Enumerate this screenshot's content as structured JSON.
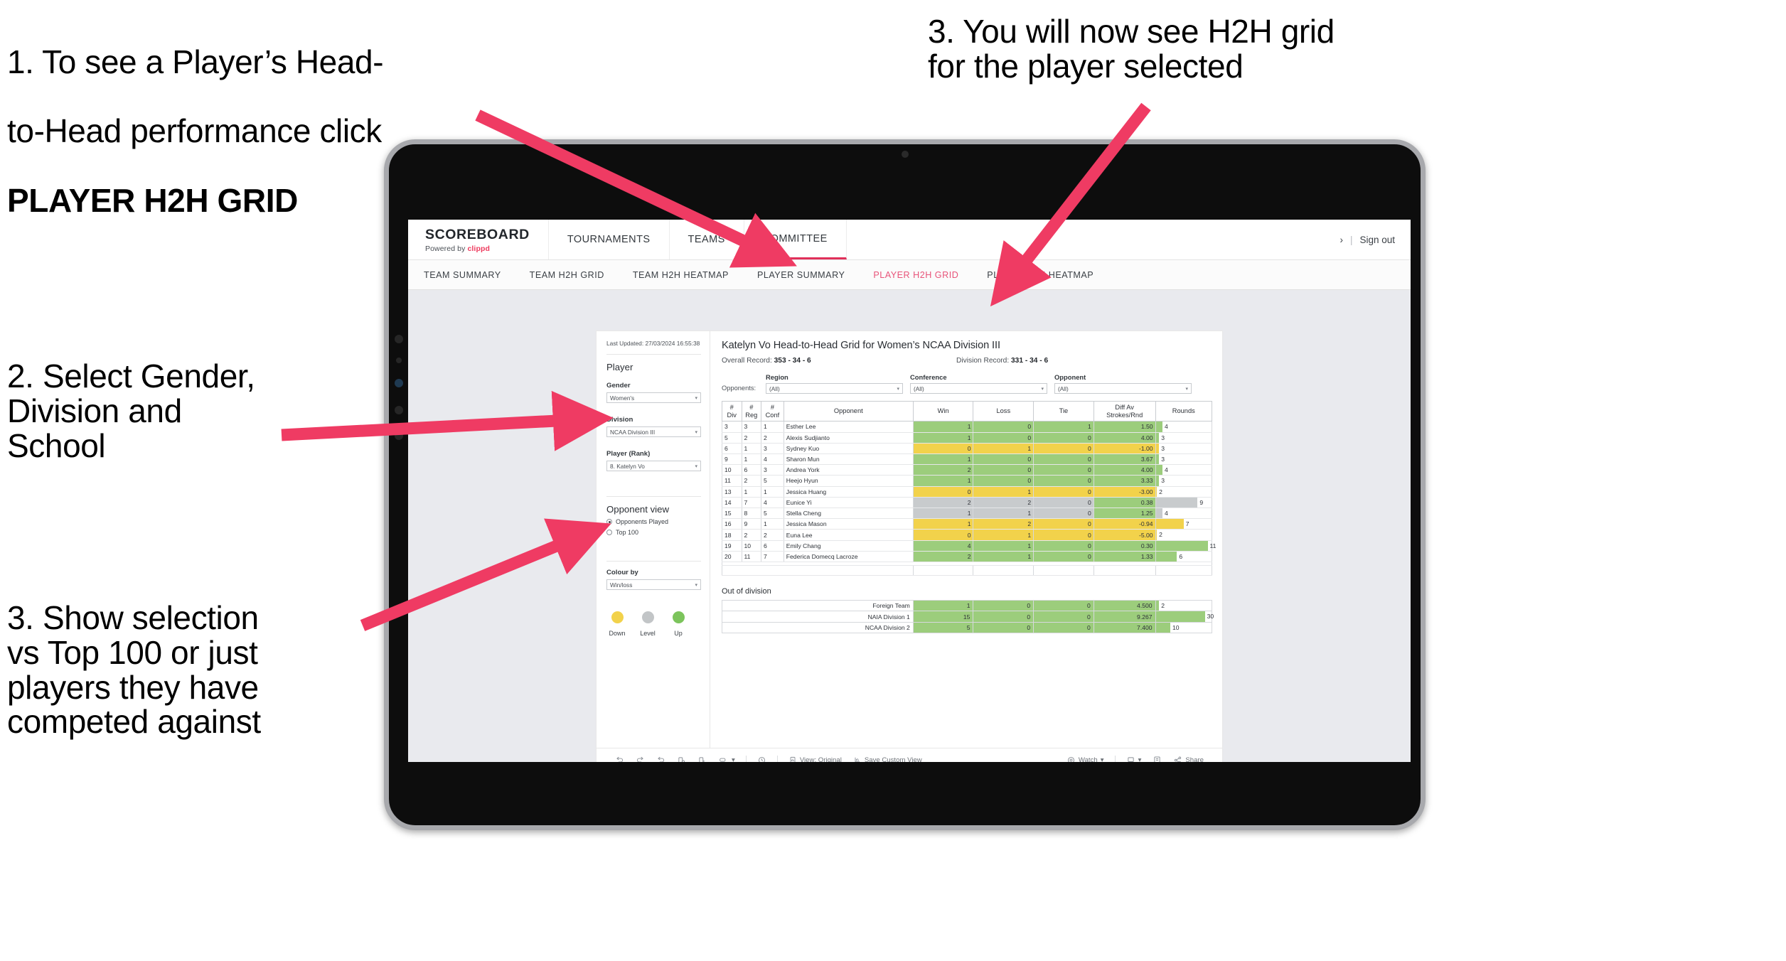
{
  "annotations": {
    "a1_line1": "1. To see a Player’s Head-",
    "a1_line2": "to-Head performance click",
    "a1_bold": "PLAYER H2H GRID",
    "a2": "2. Select Gender,\nDivision and\nSchool",
    "a3": "3. Show selection\nvs Top 100 or just\nplayers they have\ncompeted against",
    "a4": "3. You will now see H2H grid\nfor the player selected",
    "arrow_color": "#ef3b63"
  },
  "topnav": {
    "brand_main": "SCOREBOARD",
    "brand_sub_prefix": "Powered by ",
    "brand_sub_accent": "clippd",
    "items": [
      {
        "label": "TOURNAMENTS"
      },
      {
        "label": "TEAMS"
      },
      {
        "label": "COMMITTEE"
      }
    ],
    "right_chevron": "›",
    "right_sep": "|",
    "sign_out": "Sign out"
  },
  "subnav": {
    "tabs": [
      {
        "label": "TEAM SUMMARY",
        "active": false
      },
      {
        "label": "TEAM H2H GRID",
        "active": false
      },
      {
        "label": "TEAM H2H HEATMAP",
        "active": false
      },
      {
        "label": "PLAYER SUMMARY",
        "active": false
      },
      {
        "label": "PLAYER H2H GRID",
        "active": true
      },
      {
        "label": "PLAYER H2H HEATMAP",
        "active": false
      }
    ],
    "active_color": "#e8547a"
  },
  "filters": {
    "last_updated": "Last Updated: 27/03/2024 16:55:38",
    "section_player": "Player",
    "gender_label": "Gender",
    "gender_value": "Women's",
    "division_label": "Division",
    "division_value": "NCAA Division III",
    "player_label": "Player (Rank)",
    "player_value": "8. Katelyn Vo",
    "opponent_view_title": "Opponent view",
    "opponent_view_options": [
      {
        "label": "Opponents Played",
        "selected": true
      },
      {
        "label": "Top 100",
        "selected": false
      }
    ],
    "colour_by_label": "Colour by",
    "colour_by_value": "Win/loss",
    "legend": [
      {
        "label": "Down",
        "color": "#f2d24b"
      },
      {
        "label": "Level",
        "color": "#c2c5c7"
      },
      {
        "label": "Up",
        "color": "#7cc45c"
      }
    ]
  },
  "view": {
    "title": "Katelyn Vo Head-to-Head Grid for Women’s NCAA Division III",
    "overall_record_label": "Overall Record:",
    "overall_record_value": "353 -  34 - 6",
    "division_record_label": "Division Record:",
    "division_record_value": "331 -  34 - 6",
    "opponents_label": "Opponents:",
    "opp_filters": [
      {
        "label": "Region",
        "value": "(All)"
      },
      {
        "label": "Conference",
        "value": "(All)"
      },
      {
        "label": "Opponent",
        "value": "(All)"
      }
    ]
  },
  "table": {
    "headers": [
      "#\nDiv",
      "#\nReg",
      "#\nConf",
      "Opponent",
      "Win",
      "Loss",
      "Tie",
      "Diff Av\nStrokes/Rnd",
      "Rounds"
    ],
    "rows": [
      {
        "div": "3",
        "reg": "3",
        "conf": "1",
        "opponent": "Esther Lee",
        "win": "1",
        "loss": "0",
        "tie": "1",
        "diff": "1.50",
        "rounds": "4",
        "color": "#9ccd7c",
        "bar_pct": 12
      },
      {
        "div": "5",
        "reg": "2",
        "conf": "2",
        "opponent": "Alexis Sudjianto",
        "win": "1",
        "loss": "0",
        "tie": "0",
        "diff": "4.00",
        "rounds": "3",
        "color": "#9ccd7c",
        "bar_pct": 6
      },
      {
        "div": "6",
        "reg": "1",
        "conf": "3",
        "opponent": "Sydney Kuo",
        "win": "0",
        "loss": "1",
        "tie": "0",
        "diff": "-1.00",
        "rounds": "3",
        "color": "#f2d24b",
        "bar_pct": 6
      },
      {
        "div": "9",
        "reg": "1",
        "conf": "4",
        "opponent": "Sharon Mun",
        "win": "1",
        "loss": "0",
        "tie": "0",
        "diff": "3.67",
        "rounds": "3",
        "color": "#9ccd7c",
        "bar_pct": 6
      },
      {
        "div": "10",
        "reg": "6",
        "conf": "3",
        "opponent": "Andrea York",
        "win": "2",
        "loss": "0",
        "tie": "0",
        "diff": "4.00",
        "rounds": "4",
        "color": "#9ccd7c",
        "bar_pct": 12
      },
      {
        "div": "11",
        "reg": "2",
        "conf": "5",
        "opponent": "Heejo Hyun",
        "win": "1",
        "loss": "0",
        "tie": "0",
        "diff": "3.33",
        "rounds": "3",
        "color": "#9ccd7c",
        "bar_pct": 6
      },
      {
        "div": "13",
        "reg": "1",
        "conf": "1",
        "opponent": "Jessica Huang",
        "win": "0",
        "loss": "1",
        "tie": "0",
        "diff": "-3.00",
        "rounds": "2",
        "color": "#f2d24b",
        "bar_pct": 2
      },
      {
        "div": "14",
        "reg": "7",
        "conf": "4",
        "opponent": "Eunice Yi",
        "win": "2",
        "loss": "2",
        "tie": "0",
        "diff": "0.38",
        "rounds": "9",
        "color": "#c8cbcd",
        "bar_pct": 75,
        "diff_color": "#9ccd7c"
      },
      {
        "div": "15",
        "reg": "8",
        "conf": "5",
        "opponent": "Stella Cheng",
        "win": "1",
        "loss": "1",
        "tie": "0",
        "diff": "1.25",
        "rounds": "4",
        "color": "#c8cbcd",
        "bar_pct": 12,
        "diff_color": "#9ccd7c"
      },
      {
        "div": "16",
        "reg": "9",
        "conf": "1",
        "opponent": "Jessica Mason",
        "win": "1",
        "loss": "2",
        "tie": "0",
        "diff": "-0.94",
        "rounds": "7",
        "color": "#f2d24b",
        "bar_pct": 50
      },
      {
        "div": "18",
        "reg": "2",
        "conf": "2",
        "opponent": "Euna Lee",
        "win": "0",
        "loss": "1",
        "tie": "0",
        "diff": "-5.00",
        "rounds": "2",
        "color": "#f2d24b",
        "bar_pct": 2
      },
      {
        "div": "19",
        "reg": "10",
        "conf": "6",
        "opponent": "Emily Chang",
        "win": "4",
        "loss": "1",
        "tie": "0",
        "diff": "0.30",
        "rounds": "11",
        "color": "#9ccd7c",
        "bar_pct": 93
      },
      {
        "div": "20",
        "reg": "11",
        "conf": "7",
        "opponent": "Federica Domecq Lacroze",
        "win": "2",
        "loss": "1",
        "tie": "0",
        "diff": "1.33",
        "rounds": "6",
        "color": "#9ccd7c",
        "bar_pct": 38
      }
    ]
  },
  "out_of_division": {
    "title": "Out of division",
    "rows": [
      {
        "name": "Foreign Team",
        "win": "1",
        "loss": "0",
        "tie": "0",
        "diff": "4.500",
        "rounds": "2",
        "color": "#9ccd7c",
        "bar_pct": 6
      },
      {
        "name": "NAIA Division 1",
        "win": "15",
        "loss": "0",
        "tie": "0",
        "diff": "9.267",
        "rounds": "30",
        "color": "#9ccd7c",
        "bar_pct": 88
      },
      {
        "name": "NCAA Division 2",
        "win": "5",
        "loss": "0",
        "tie": "0",
        "diff": "7.400",
        "rounds": "10",
        "color": "#9ccd7c",
        "bar_pct": 26
      }
    ]
  },
  "vizbar": {
    "view_original": "View: Original",
    "save_custom_view": "Save Custom View",
    "watch": "Watch",
    "share": "Share",
    "caret": "▾"
  }
}
